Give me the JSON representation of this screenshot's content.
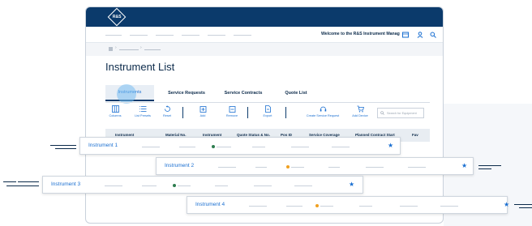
{
  "app": {
    "logo_text": "R&S"
  },
  "header": {
    "welcome_text": "Welcome to the R&S Instrument Manag"
  },
  "page": {
    "title": "Instrument List"
  },
  "tabs": [
    {
      "label": "Instruments",
      "active": true
    },
    {
      "label": "Service Requests",
      "active": false
    },
    {
      "label": "Service Contracts",
      "active": false
    },
    {
      "label": "Quote List",
      "active": false
    }
  ],
  "toolbar": {
    "columns": "Columns",
    "list_presets": "List Presets",
    "reset": "Reset",
    "add": "Add",
    "remove": "Remove",
    "export": "Export",
    "create_service_request": "Create Service Request",
    "add_device": "Add Device",
    "search_placeholder": "Search for Equipment"
  },
  "table": {
    "columns": [
      "Instrument",
      "Material No.",
      "Instrument",
      "Quote Status & No.",
      "Pos ID",
      "Service Coverage",
      "Planned Contract Start",
      "Fav"
    ]
  },
  "rows": [
    {
      "name": "Instrument 1",
      "status_color": "#2e7d4f",
      "favorite": true
    },
    {
      "name": "Instrument 2",
      "status_color": "#f0a020",
      "favorite": true
    },
    {
      "name": "Instrument 3",
      "status_color": "#2e7d4f",
      "favorite": true
    },
    {
      "name": "Instrument 4",
      "status_color": "#f0a020",
      "favorite": true
    }
  ],
  "colors": {
    "brand": "#0b3a6b",
    "accent": "#1a6fd1",
    "ok": "#2e7d4f",
    "warn": "#f0a020"
  },
  "icons": [
    "logo-icon",
    "notifications-icon",
    "user-icon",
    "search-icon",
    "home-icon",
    "columns-icon",
    "list-presets-icon",
    "reset-icon",
    "add-icon",
    "remove-icon",
    "export-icon",
    "create-service-request-icon",
    "add-device-icon",
    "star-icon"
  ]
}
